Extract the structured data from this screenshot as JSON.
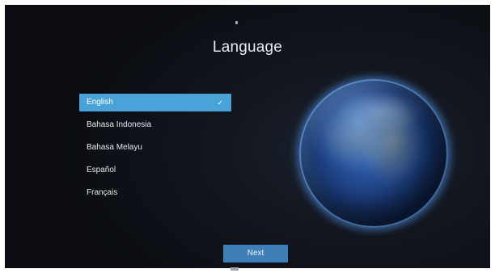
{
  "page": {
    "title": "Language"
  },
  "languages": {
    "items": [
      {
        "label": "English",
        "selected": true
      },
      {
        "label": "Bahasa Indonesia",
        "selected": false
      },
      {
        "label": "Bahasa Melayu",
        "selected": false
      },
      {
        "label": "Español",
        "selected": false
      },
      {
        "label": "Français",
        "selected": false
      }
    ],
    "check_glyph": "✓"
  },
  "footer": {
    "next_label": "Next"
  },
  "icons": {
    "selection": "check-icon",
    "illustration": "globe-earth-icon"
  },
  "colors": {
    "selected_background": "#4aa3d8",
    "button_background": "#3f7fb8",
    "screen_background": "#0b0d12"
  }
}
